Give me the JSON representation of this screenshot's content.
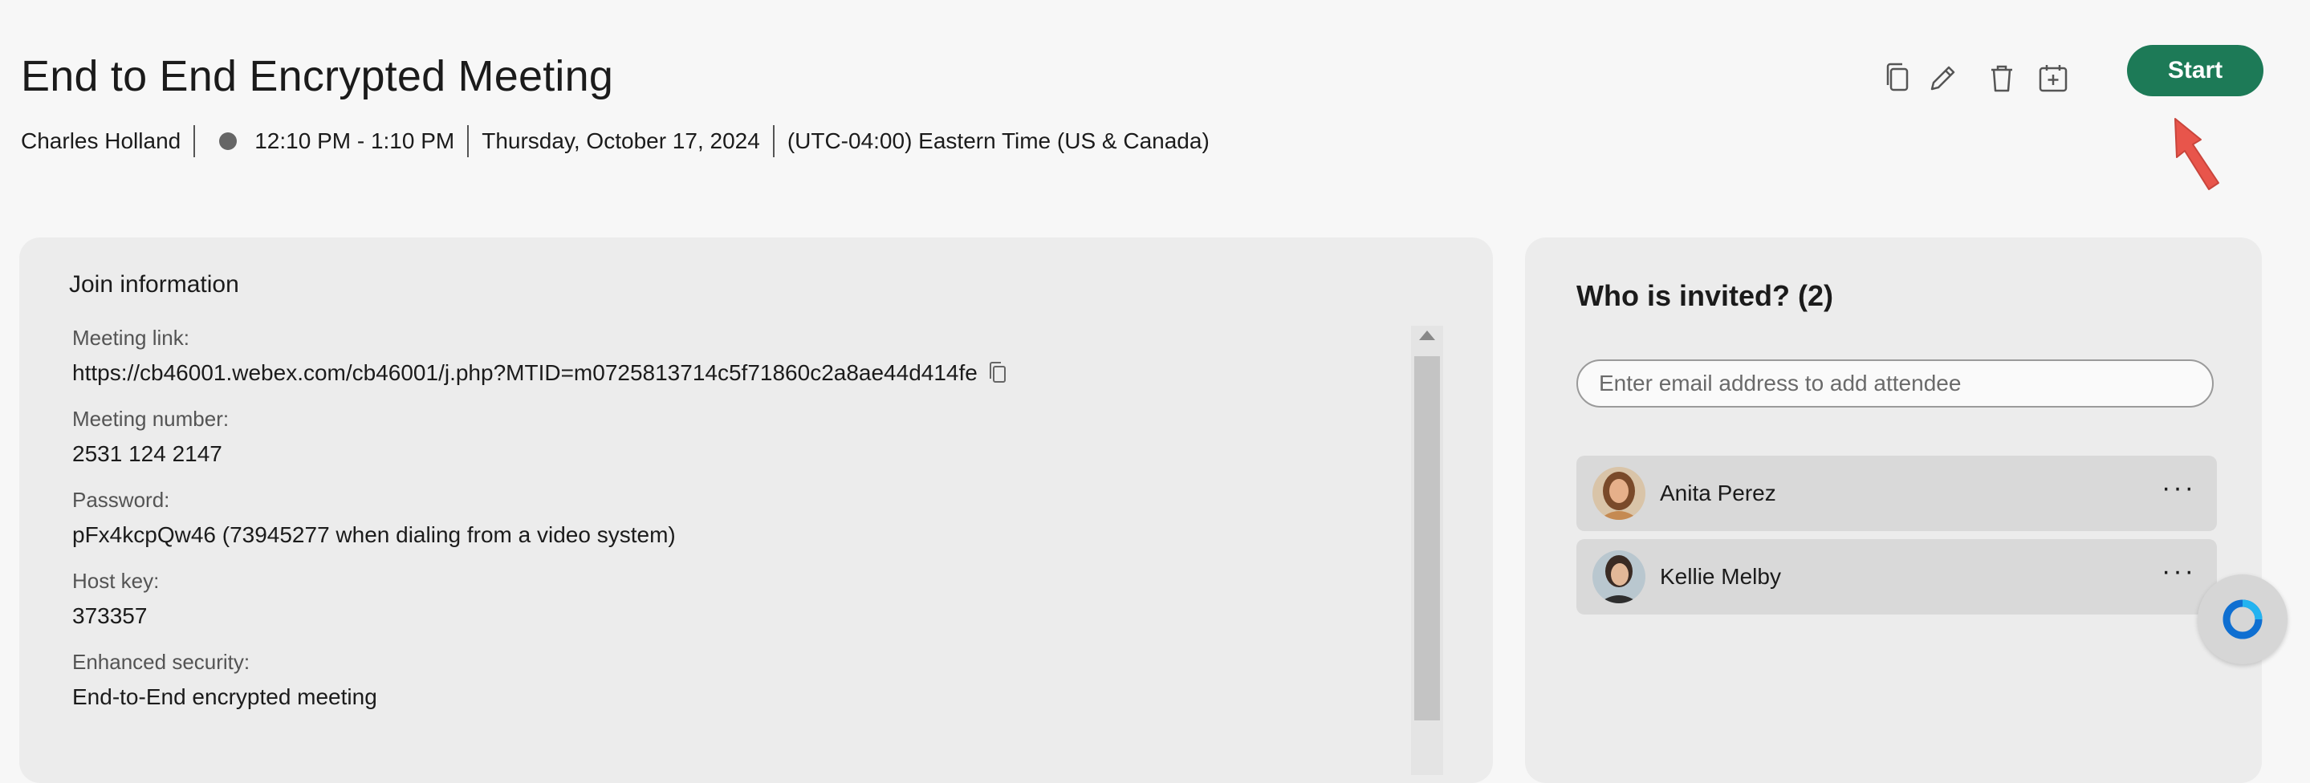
{
  "meeting": {
    "title": "End to End Encrypted Meeting",
    "host": "Charles Holland",
    "time": "12:10 PM - 1:10 PM",
    "date": "Thursday, October 17, 2024",
    "timezone": "(UTC-04:00) Eastern Time (US & Canada)"
  },
  "toolbar": {
    "icons": [
      "copy-icon",
      "edit-icon",
      "delete-icon",
      "add-to-calendar-icon"
    ],
    "start_label": "Start"
  },
  "join": {
    "title": "Join information",
    "fields": [
      {
        "label": "Meeting link:",
        "value": "https://cb46001.webex.com/cb46001/j.php?MTID=m0725813714c5f71860c2a8ae44d414fe"
      },
      {
        "label": "Meeting number:",
        "value": "2531 124 2147"
      },
      {
        "label": "Password:",
        "value": "pFx4kcpQw46 (73945277 when dialing from a video system)"
      },
      {
        "label": "Host key:",
        "value": "373357"
      },
      {
        "label": "Enhanced security:",
        "value": "End-to-End encrypted meeting"
      }
    ]
  },
  "invite": {
    "title": "Who is invited? (2)",
    "email_placeholder": "Enter email address to add attendee",
    "attendees": [
      {
        "name": "Anita Perez",
        "more": "···"
      },
      {
        "name": "Kellie Melby",
        "more": "···"
      }
    ]
  },
  "colors": {
    "start_button": "#1d7a57",
    "panel_bg": "#ececec",
    "page_bg": "#f7f7f7",
    "annotation_arrow": "#e8554b",
    "fab_ring": "#1a8ce6"
  }
}
